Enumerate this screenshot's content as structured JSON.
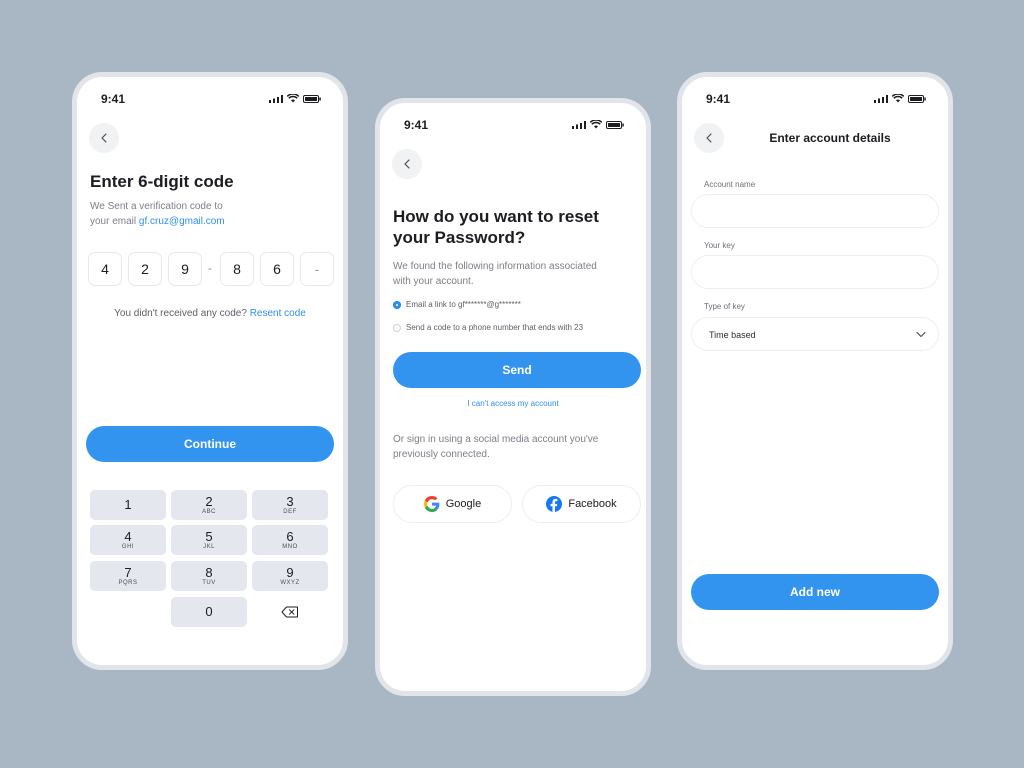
{
  "status_time": "9:41",
  "screen1": {
    "title": "Enter 6-digit code",
    "subtitle_line1": "We Sent a verification code to",
    "subtitle_prefix": "your email ",
    "email": "gf.cruz@gmail.com",
    "code_digits": [
      "4",
      "2",
      "9",
      "8",
      "6",
      "-"
    ],
    "code_separator": "-",
    "no_code_text": "You didn't received any code? ",
    "resend_link": "Resent code",
    "continue_label": "Continue",
    "keypad": [
      {
        "num": "1",
        "letters": ""
      },
      {
        "num": "2",
        "letters": "ABC"
      },
      {
        "num": "3",
        "letters": "DEF"
      },
      {
        "num": "4",
        "letters": "GHI"
      },
      {
        "num": "5",
        "letters": "JKL"
      },
      {
        "num": "6",
        "letters": "MNO"
      },
      {
        "num": "7",
        "letters": "PQRS"
      },
      {
        "num": "8",
        "letters": "TUV"
      },
      {
        "num": "9",
        "letters": "WXYZ"
      },
      {
        "num": "0",
        "letters": ""
      }
    ]
  },
  "screen2": {
    "title_line1": "How do you want to reset",
    "title_line2": "your Password?",
    "desc_line1": "We found the following information associated",
    "desc_line2": "with your account.",
    "option1": "Email a link to gf*******@g*******",
    "option2": "Send a code to a phone number that ends with 23",
    "send_label": "Send",
    "cant_access": "I can't access my account",
    "social_line1": "Or sign in using a social media account you've",
    "social_line2": "previously connected.",
    "google_label": "Google",
    "facebook_label": "Facebook"
  },
  "screen3": {
    "title": "Enter account details",
    "account_name_label": "Account name",
    "account_name_value": "",
    "your_key_label": "Your key",
    "your_key_value": "",
    "type_of_key_label": "Type of key",
    "type_of_key_value": "Time based",
    "add_new_label": "Add new"
  },
  "colors": {
    "background": "#a9b6c4",
    "accent": "#3394ef",
    "link": "#2f8ff0"
  }
}
